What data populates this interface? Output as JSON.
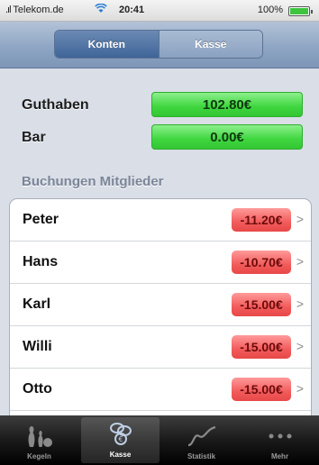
{
  "status_bar": {
    "carrier": "Telekom.de",
    "time": "20:41",
    "battery_percent_text": "100%",
    "battery_level": 1.0,
    "wifi_icon": "wifi-icon"
  },
  "navbar": {
    "segments": [
      "Konten",
      "Kasse"
    ],
    "selected_segment": "Konten"
  },
  "balances": [
    {
      "label": "Guthaben",
      "value": "102.80€"
    },
    {
      "label": "Bar",
      "value": "0.00€"
    }
  ],
  "section_header": "Buchungen Mitglieder",
  "members": [
    {
      "name": "Peter",
      "amount": "-11.20€"
    },
    {
      "name": "Hans",
      "amount": "-10.70€"
    },
    {
      "name": "Karl",
      "amount": "-15.00€"
    },
    {
      "name": "Willi",
      "amount": "-15.00€"
    },
    {
      "name": "Otto",
      "amount": "-15.00€"
    },
    {
      "name": "",
      "amount": ""
    }
  ],
  "tabbar": {
    "tabs": [
      {
        "label": "Kegeln",
        "icon": "bowling-pins-icon"
      },
      {
        "label": "Kasse",
        "icon": "coins-icon"
      },
      {
        "label": "Statistik",
        "icon": "chart-line-icon"
      },
      {
        "label": "Mehr",
        "icon": "more-dots-icon"
      }
    ],
    "active_tab": "Kasse"
  },
  "colors": {
    "positive_pill": "#3fd63f",
    "negative_pill": "#f25b5b",
    "nav_bar": "#8fa6c4",
    "tab_bar": "#1a1a1a"
  }
}
